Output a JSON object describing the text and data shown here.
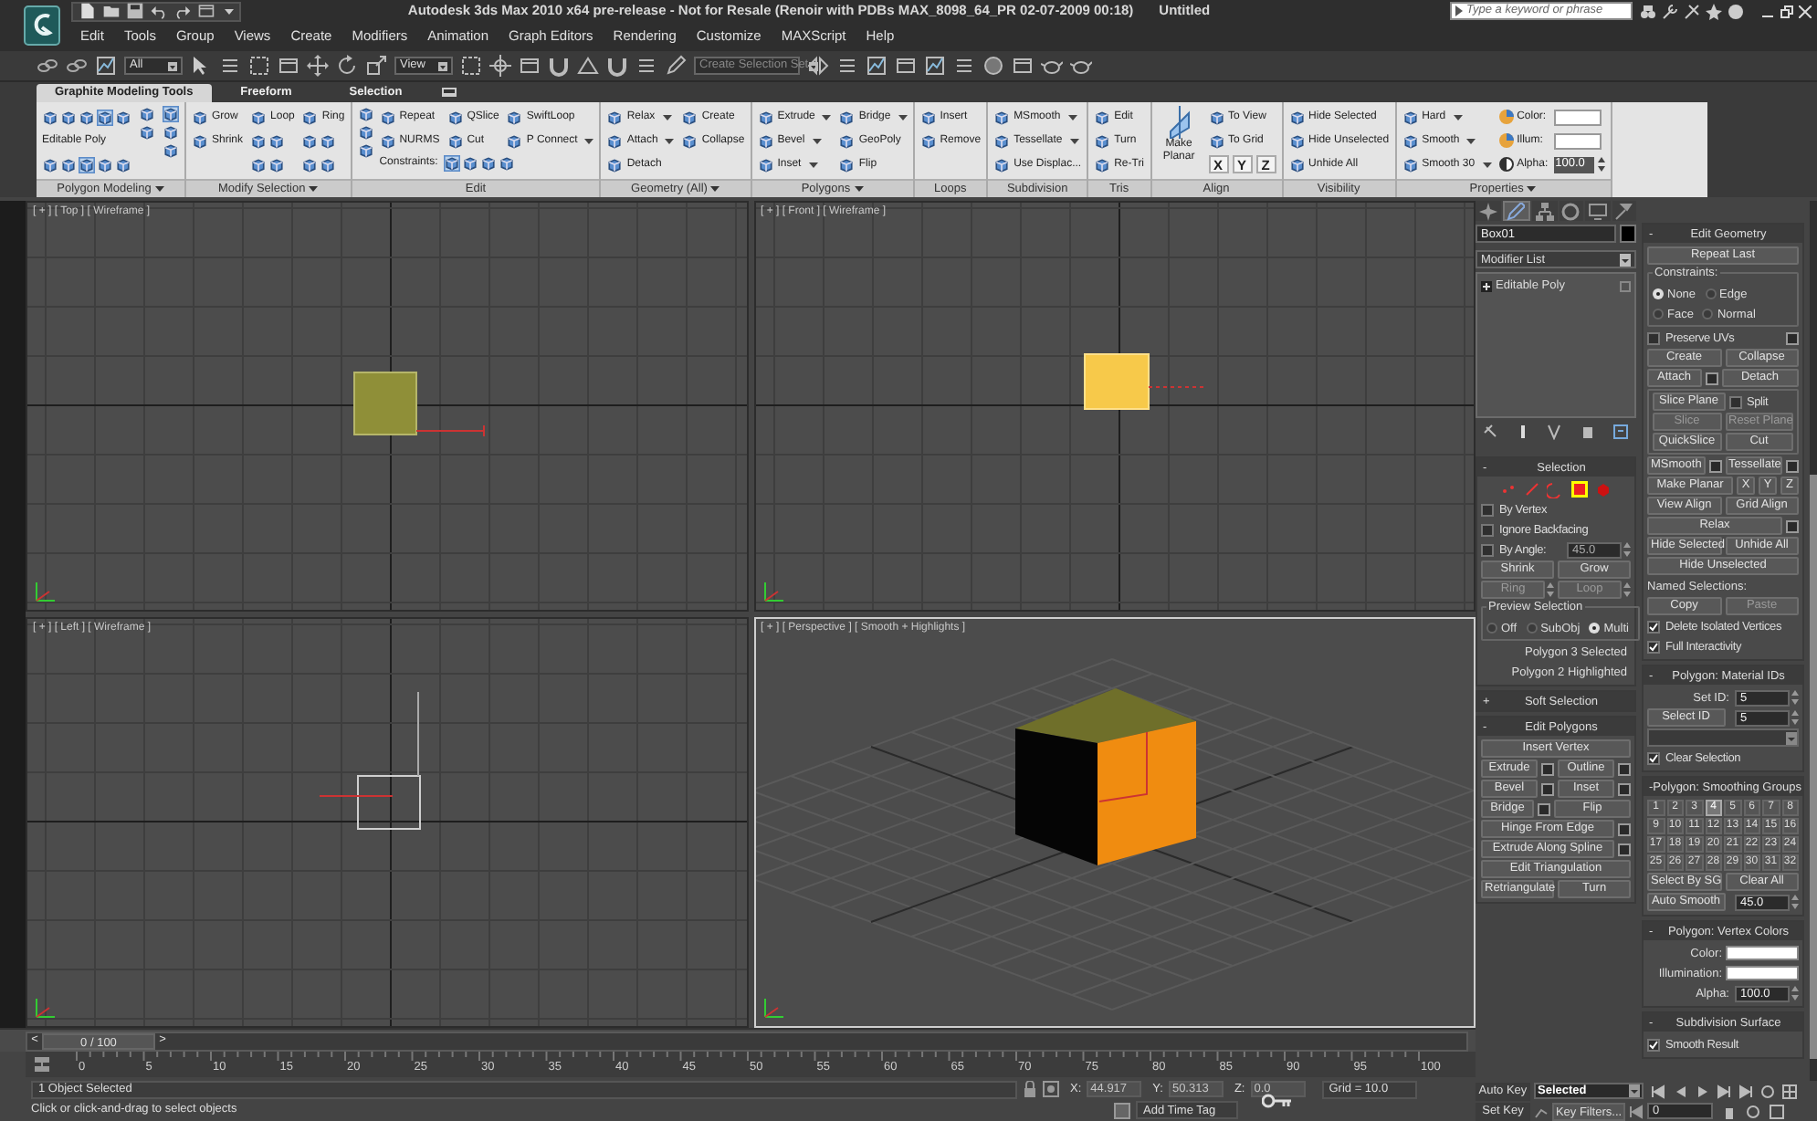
{
  "window": {
    "title": "Autodesk 3ds Max  2010 x64 pre-release - Not for Resale (Renoir with PDBs MAX_8098_64_PR 02-07-2009 00:18)",
    "document": "Untitled"
  },
  "search": {
    "placeholder": "Type a keyword or phrase"
  },
  "menu": [
    "Edit",
    "Tools",
    "Group",
    "Views",
    "Create",
    "Modifiers",
    "Animation",
    "Graph Editors",
    "Rendering",
    "Customize",
    "MAXScript",
    "Help"
  ],
  "toolbar": {
    "selection_filter": "All",
    "reference_coordinates": "View",
    "selection_set_placeholder": "Create Selection Set"
  },
  "ribbon": {
    "tabs": [
      {
        "label": "Graphite Modeling Tools",
        "selected": true
      },
      {
        "label": "Freeform",
        "selected": false
      },
      {
        "label": "Selection",
        "selected": false
      }
    ],
    "groups": [
      {
        "label": "Polygon Modeling",
        "menu": true,
        "columns": [
          [
            {
              "kind": "iconrow",
              "icons": [
                {
                  "selected": false
                },
                {
                  "selected": false
                },
                {
                  "selected": false
                },
                {
                  "selected": true
                },
                {
                  "selected": false
                }
              ]
            },
            {
              "kind": "label",
              "label": "Editable Poly"
            },
            {
              "kind": "iconrow",
              "icons": [
                {
                  "selected": false
                },
                {
                  "selected": false
                },
                {
                  "selected": true
                },
                {
                  "selected": false
                },
                {
                  "selected": false
                }
              ]
            }
          ],
          [
            {
              "kind": "icon",
              "selected": false
            },
            {
              "kind": "icon",
              "selected": false
            }
          ],
          [
            {
              "kind": "icon",
              "selected": true
            },
            {
              "kind": "icon",
              "selected": false
            },
            {
              "kind": "icon",
              "selected": false
            }
          ]
        ]
      },
      {
        "label": "Modify Selection",
        "menu": true,
        "columns": [
          [
            {
              "kind": "button",
              "label": "Grow"
            },
            {
              "kind": "button",
              "label": "Shrink"
            }
          ],
          [
            {
              "kind": "button",
              "label": "Loop"
            },
            {
              "kind": "iconrow",
              "icons": [
                {
                  "selected": false
                },
                {
                  "selected": false
                }
              ]
            },
            {
              "kind": "iconrow",
              "icons": [
                {
                  "selected": false
                },
                {
                  "selected": false
                }
              ]
            }
          ],
          [
            {
              "kind": "button",
              "label": "Ring"
            },
            {
              "kind": "iconrow",
              "icons": [
                {
                  "selected": false
                },
                {
                  "selected": false
                }
              ]
            },
            {
              "kind": "iconrow",
              "icons": [
                {
                  "selected": false
                },
                {
                  "selected": false
                }
              ]
            }
          ]
        ]
      },
      {
        "label": "Edit",
        "menu": false,
        "lead": [
          {
            "kind": "icon",
            "selected": false
          },
          {
            "kind": "icon",
            "selected": false
          },
          {
            "kind": "icon",
            "selected": false
          }
        ],
        "columns": [
          [
            {
              "kind": "button",
              "label": "Repeat"
            },
            {
              "kind": "button",
              "label": "NURMS"
            }
          ],
          [
            {
              "kind": "button",
              "label": "QSlice"
            },
            {
              "kind": "button",
              "label": "Cut"
            }
          ],
          [
            {
              "kind": "button",
              "label": "SwiftLoop"
            },
            {
              "kind": "dropdown",
              "label": "P Connect"
            }
          ]
        ],
        "footer": {
          "kind": "iconrow",
          "label": "Constraints:",
          "icons": [
            {
              "selected": true
            },
            {
              "selected": false
            },
            {
              "selected": false
            },
            {
              "selected": false
            }
          ]
        }
      },
      {
        "label": "Geometry (All)",
        "menu": true,
        "columns": [
          [
            {
              "kind": "dropdown",
              "label": "Relax"
            },
            {
              "kind": "dropdown",
              "label": "Attach"
            },
            {
              "kind": "button",
              "label": "Detach"
            }
          ],
          [
            {
              "kind": "button",
              "label": "Create"
            },
            {
              "kind": "button",
              "label": "Collapse"
            }
          ]
        ]
      },
      {
        "label": "Polygons",
        "menu": true,
        "columns": [
          [
            {
              "kind": "dropdown",
              "label": "Extrude"
            },
            {
              "kind": "dropdown",
              "label": "Bevel"
            },
            {
              "kind": "dropdown",
              "label": "Inset"
            }
          ],
          [
            {
              "kind": "dropdown",
              "label": "Bridge"
            },
            {
              "kind": "button",
              "label": "GeoPoly"
            },
            {
              "kind": "button",
              "label": "Flip"
            }
          ]
        ]
      },
      {
        "label": "Loops",
        "menu": false,
        "columns": [
          [
            {
              "kind": "button",
              "label": "Insert"
            },
            {
              "kind": "button",
              "label": "Remove"
            }
          ]
        ]
      },
      {
        "label": "Subdivision",
        "menu": false,
        "columns": [
          [
            {
              "kind": "dropdown",
              "label": "MSmooth"
            },
            {
              "kind": "dropdown",
              "label": "Tessellate"
            },
            {
              "kind": "button",
              "label": "Use Displac..."
            }
          ]
        ]
      },
      {
        "label": "Tris",
        "menu": false,
        "columns": [
          [
            {
              "kind": "button",
              "label": "Edit"
            },
            {
              "kind": "button",
              "label": "Turn"
            },
            {
              "kind": "button",
              "label": "Re-Tri"
            }
          ]
        ]
      },
      {
        "label": "Align",
        "menu": false,
        "columns": [
          [
            {
              "kind": "big",
              "label": "Make Planar"
            }
          ],
          [
            {
              "kind": "button",
              "label": "To View"
            },
            {
              "kind": "button",
              "label": "To Grid"
            },
            {
              "kind": "axis",
              "labels": [
                "X",
                "Y",
                "Z"
              ]
            }
          ]
        ]
      },
      {
        "label": "Visibility",
        "menu": false,
        "columns": [
          [
            {
              "kind": "button",
              "label": "Hide Selected"
            },
            {
              "kind": "button",
              "label": "Hide Unselected"
            },
            {
              "kind": "button",
              "label": "Unhide All"
            }
          ]
        ]
      },
      {
        "label": "Properties",
        "menu": true,
        "columns": [
          [
            {
              "kind": "dropdown",
              "label": "Hard"
            },
            {
              "kind": "dropdown",
              "label": "Smooth"
            },
            {
              "kind": "dropdown",
              "label": "Smooth 30"
            }
          ],
          [
            {
              "kind": "swatch",
              "label": "Color:"
            },
            {
              "kind": "swatch",
              "label": "Illum:"
            },
            {
              "kind": "spinner",
              "label": "Alpha:",
              "value": "100.0"
            }
          ]
        ]
      }
    ]
  },
  "viewports": [
    {
      "label": "[ + ] [ Top ] [ Wireframe ]",
      "kind": "top",
      "active": false
    },
    {
      "label": "[ + ] [ Front ] [ Wireframe ]",
      "kind": "front",
      "active": false
    },
    {
      "label": "[ + ] [ Left ] [ Wireframe ]",
      "kind": "left",
      "active": false
    },
    {
      "label": "[ + ] [ Perspective ] [ Smooth + Highlights ]",
      "kind": "perspective",
      "active": true
    }
  ],
  "command_panel": {
    "tabs": [
      {
        "selected": false
      },
      {
        "selected": true
      },
      {
        "selected": false
      },
      {
        "selected": false
      },
      {
        "selected": false
      },
      {
        "selected": false
      }
    ],
    "object_name": "Box01",
    "modifier_list": "Modifier List",
    "stack": [
      {
        "label": "Editable Poly"
      }
    ],
    "left_rollouts": [
      {
        "sign": "-",
        "title": "Selection",
        "rows": [
          [
            {
              "kind": "subobj",
              "icons": [
                {
                  "selected": false
                },
                {
                  "selected": false
                },
                {
                  "selected": false
                },
                {
                  "selected": true
                },
                {
                  "selected": false
                }
              ]
            }
          ],
          [
            {
              "kind": "checkbox",
              "label": "By Vertex",
              "checked": false
            }
          ],
          [
            {
              "kind": "checkbox",
              "label": "Ignore Backfacing",
              "checked": false
            }
          ],
          [
            {
              "kind": "checkbox",
              "label": "By Angle:",
              "checked": false
            },
            {
              "kind": "spinner",
              "value": "45.0",
              "disabled": true
            }
          ],
          [
            {
              "kind": "button",
              "label": "Shrink",
              "disabled": false
            },
            {
              "kind": "button",
              "label": "Grow",
              "disabled": false
            }
          ],
          [
            {
              "kind": "button_spin",
              "label": "Ring",
              "disabled": true
            },
            {
              "kind": "button_spin",
              "label": "Loop",
              "disabled": true
            }
          ],
          [
            {
              "kind": "frame",
              "title": "Preview Selection",
              "rows": [
                [
                  {
                    "kind": "radio",
                    "label": "Off",
                    "selected": false
                  },
                  {
                    "kind": "radio",
                    "label": "SubObj",
                    "selected": false
                  },
                  {
                    "kind": "radio",
                    "label": "Multi",
                    "selected": true
                  }
                ]
              ]
            }
          ],
          [
            {
              "kind": "note",
              "label": "Polygon 3 Selected"
            }
          ],
          [
            {
              "kind": "note",
              "label": "Polygon 2 Highlighted"
            }
          ]
        ]
      },
      {
        "sign": "+",
        "title": "Soft Selection"
      },
      {
        "sign": "-",
        "title": "Edit Polygons",
        "rows": [
          [
            {
              "kind": "button",
              "label": "Insert Vertex",
              "disabled": false
            }
          ],
          [
            {
              "kind": "button_opt",
              "label": "Extrude"
            },
            {
              "kind": "button_opt",
              "label": "Outline"
            }
          ],
          [
            {
              "kind": "button_opt",
              "label": "Bevel"
            },
            {
              "kind": "button_opt",
              "label": "Inset"
            }
          ],
          [
            {
              "kind": "button_opt",
              "label": "Bridge"
            },
            {
              "kind": "button",
              "label": "Flip",
              "disabled": false
            }
          ],
          [
            {
              "kind": "button_opt",
              "label": "Hinge From Edge"
            }
          ],
          [
            {
              "kind": "button_opt",
              "label": "Extrude Along Spline"
            }
          ],
          [
            {
              "kind": "button",
              "label": "Edit Triangulation",
              "disabled": false
            }
          ],
          [
            {
              "kind": "button",
              "label": "Retriangulate",
              "disabled": false
            },
            {
              "kind": "button",
              "label": "Turn",
              "disabled": false
            }
          ]
        ]
      }
    ],
    "right_rollouts": [
      {
        "sign": "-",
        "title": "Edit Geometry",
        "rows": [
          [
            {
              "kind": "button",
              "label": "Repeat Last",
              "disabled": false
            }
          ],
          [
            {
              "kind": "frame",
              "title": "Constraints:",
              "rows": [
                [
                  {
                    "kind": "radio",
                    "label": "None",
                    "selected": true
                  },
                  {
                    "kind": "radio",
                    "label": "Edge",
                    "selected": false
                  }
                ],
                [
                  {
                    "kind": "radio",
                    "label": "Face",
                    "selected": false
                  },
                  {
                    "kind": "radio",
                    "label": "Normal",
                    "selected": false
                  }
                ]
              ]
            }
          ],
          [
            {
              "kind": "checkbox",
              "label": "Preserve UVs",
              "checked": false
            },
            {
              "kind": "optbox"
            }
          ],
          [
            {
              "kind": "button",
              "label": "Create",
              "disabled": false
            },
            {
              "kind": "button",
              "label": "Collapse",
              "disabled": false
            }
          ],
          [
            {
              "kind": "button_opt",
              "label": "Attach"
            },
            {
              "kind": "button",
              "label": "Detach",
              "disabled": false
            }
          ],
          [
            {
              "kind": "frame",
              "rows": [
                [
                  {
                    "kind": "button",
                    "label": "Slice Plane",
                    "disabled": false
                  },
                  {
                    "kind": "checkbox",
                    "label": "Split",
                    "checked": false
                  }
                ],
                [
                  {
                    "kind": "button",
                    "label": "Slice",
                    "disabled": true
                  },
                  {
                    "kind": "button",
                    "label": "Reset Plane",
                    "disabled": true
                  }
                ],
                [
                  {
                    "kind": "button",
                    "label": "QuickSlice",
                    "disabled": false
                  },
                  {
                    "kind": "button",
                    "label": "Cut",
                    "disabled": false
                  }
                ]
              ]
            }
          ],
          [
            {
              "kind": "button_opt",
              "label": "MSmooth"
            },
            {
              "kind": "button_opt",
              "label": "Tessellate"
            }
          ],
          [
            {
              "kind": "button",
              "label": "Make Planar",
              "disabled": false
            },
            {
              "kind": "axis",
              "label": "X"
            },
            {
              "kind": "axis",
              "label": "Y"
            },
            {
              "kind": "axis",
              "label": "Z"
            }
          ],
          [
            {
              "kind": "button",
              "label": "View Align",
              "disabled": false
            },
            {
              "kind": "button",
              "label": "Grid Align",
              "disabled": false
            }
          ],
          [
            {
              "kind": "button_opt",
              "label": "Relax"
            }
          ],
          [
            {
              "kind": "button",
              "label": "Hide Selected",
              "disabled": false
            },
            {
              "kind": "button",
              "label": "Unhide All",
              "disabled": false
            }
          ],
          [
            {
              "kind": "button",
              "label": "Hide Unselected",
              "disabled": false
            }
          ],
          [
            {
              "kind": "text",
              "label": "Named Selections:"
            }
          ],
          [
            {
              "kind": "button",
              "label": "Copy",
              "disabled": false
            },
            {
              "kind": "button",
              "label": "Paste",
              "disabled": true
            }
          ],
          [
            {
              "kind": "checkbox",
              "label": "Delete Isolated Vertices",
              "checked": true
            }
          ],
          [
            {
              "kind": "checkbox",
              "label": "Full Interactivity",
              "checked": true
            }
          ]
        ]
      },
      {
        "sign": "-",
        "title": "Polygon: Material IDs",
        "rows": [
          [
            {
              "kind": "spinner",
              "label": "Set ID:",
              "value": "5",
              "disabled": false
            }
          ],
          [
            {
              "kind": "button",
              "label": "Select ID",
              "disabled": false
            },
            {
              "kind": "spinner",
              "value": "5",
              "disabled": false
            }
          ],
          [
            {
              "kind": "dropdown"
            }
          ],
          [
            {
              "kind": "checkbox",
              "label": "Clear Selection",
              "checked": true
            }
          ]
        ]
      },
      {
        "sign": "-",
        "title": "Polygon: Smoothing Groups",
        "rows": [
          [
            {
              "kind": "sg",
              "buttons": [
                {
                  "label": "1",
                  "selected": false
                },
                {
                  "label": "2",
                  "selected": false
                },
                {
                  "label": "3",
                  "selected": false
                },
                {
                  "label": "4",
                  "selected": true
                },
                {
                  "label": "5",
                  "selected": false
                },
                {
                  "label": "6",
                  "selected": false
                },
                {
                  "label": "7",
                  "selected": false
                },
                {
                  "label": "8",
                  "selected": false
                },
                {
                  "label": "9",
                  "selected": false
                },
                {
                  "label": "10",
                  "selected": false
                },
                {
                  "label": "11",
                  "selected": false
                },
                {
                  "label": "12",
                  "selected": false
                },
                {
                  "label": "13",
                  "selected": false
                },
                {
                  "label": "14",
                  "selected": false
                },
                {
                  "label": "15",
                  "selected": false
                },
                {
                  "label": "16",
                  "selected": false
                },
                {
                  "label": "17",
                  "selected": false
                },
                {
                  "label": "18",
                  "selected": false
                },
                {
                  "label": "19",
                  "selected": false
                },
                {
                  "label": "20",
                  "selected": false
                },
                {
                  "label": "21",
                  "selected": false
                },
                {
                  "label": "22",
                  "selected": false
                },
                {
                  "label": "23",
                  "selected": false
                },
                {
                  "label": "24",
                  "selected": false
                },
                {
                  "label": "25",
                  "selected": false
                },
                {
                  "label": "26",
                  "selected": false
                },
                {
                  "label": "27",
                  "selected": false
                },
                {
                  "label": "28",
                  "selected": false
                },
                {
                  "label": "29",
                  "selected": false
                },
                {
                  "label": "30",
                  "selected": false
                },
                {
                  "label": "31",
                  "selected": false
                },
                {
                  "label": "32",
                  "selected": false
                }
              ]
            }
          ],
          [
            {
              "kind": "button",
              "label": "Select By SG",
              "disabled": false
            },
            {
              "kind": "button",
              "label": "Clear All",
              "disabled": false
            }
          ],
          [
            {
              "kind": "button",
              "label": "Auto Smooth",
              "disabled": false
            },
            {
              "kind": "spinner",
              "value": "45.0",
              "disabled": false
            }
          ]
        ]
      },
      {
        "sign": "-",
        "title": "Polygon: Vertex Colors",
        "rows": [
          [
            {
              "kind": "swatch",
              "label": "Color:"
            }
          ],
          [
            {
              "kind": "swatch",
              "label": "Illumination:"
            }
          ],
          [
            {
              "kind": "spinner",
              "label": "Alpha:",
              "value": "100.0",
              "disabled": false
            }
          ]
        ]
      },
      {
        "sign": "-",
        "title": "Subdivision Surface",
        "rows": [
          [
            {
              "kind": "checkbox",
              "label": "Smooth Result",
              "checked": true
            }
          ]
        ]
      }
    ]
  },
  "timeline": {
    "prev": "<",
    "position": "0 / 100",
    "level": 0,
    "next": ">",
    "ticks": [
      "0",
      "5",
      "10",
      "15",
      "20",
      "25",
      "30",
      "35",
      "40",
      "45",
      "50",
      "55",
      "60",
      "65",
      "70",
      "75",
      "80",
      "85",
      "90",
      "95",
      "100"
    ]
  },
  "status": {
    "selection": "1 Object Selected",
    "prompt": "Click or click-and-drag to select objects",
    "coordinates": [
      {
        "label": "X:",
        "value": "44.917"
      },
      {
        "label": "Y:",
        "value": "50.313"
      },
      {
        "label": "Z:",
        "value": "0.0"
      }
    ],
    "grid": "Grid = 10.0",
    "time_tag": "Add Time Tag"
  },
  "animation": {
    "auto_key": "Auto Key",
    "key_mode": "Selected",
    "set_key": "Set Key",
    "key_filters": "Key Filters...",
    "frame": "0"
  }
}
